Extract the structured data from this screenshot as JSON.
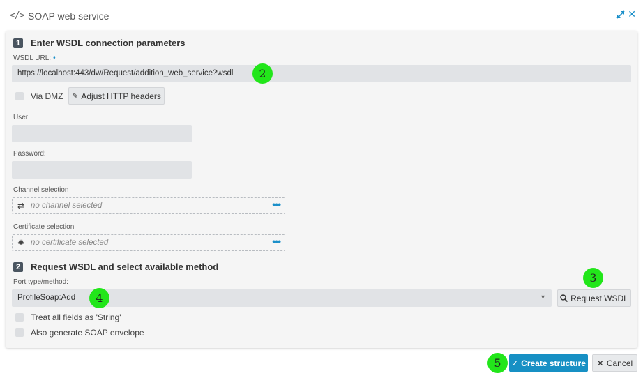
{
  "window": {
    "title": "SOAP web service",
    "title_icon": "</>",
    "close_symbol": "✕"
  },
  "section1": {
    "number": "1",
    "title": "Enter WSDL connection parameters",
    "wsdl_url_label": "WSDL URL:",
    "required_mark": "•",
    "wsdl_url_value": "https://localhost:443/dw/Request/addition_web_service?wsdl",
    "via_dmz_label": "Via DMZ",
    "adjust_headers_label": "Adjust HTTP headers",
    "user_label": "User:",
    "user_value": "",
    "password_label": "Password:",
    "password_value": "",
    "channel_label": "Channel selection",
    "channel_placeholder": "no channel selected",
    "certificate_label": "Certificate selection",
    "certificate_placeholder": "no certificate selected",
    "more_dots": "•••"
  },
  "section2": {
    "number": "2",
    "title": "Request WSDL and select available method",
    "port_label": "Port type/method:",
    "port_value": "ProfileSoap:Add",
    "request_wsdl_label": "Request WSDL",
    "treat_string_label": "Treat all fields as 'String'",
    "soap_envelope_label": "Also generate SOAP envelope"
  },
  "footer": {
    "create_label": "Create structure",
    "cancel_label": "Cancel"
  },
  "markers": [
    "2",
    "3",
    "4",
    "5"
  ],
  "colors": {
    "accent": "#1790c4",
    "marker": "#22e61a",
    "field_bg": "#e1e3e6"
  },
  "icons": {
    "title": "code-icon",
    "expand": "expand-icon",
    "close": "close-icon",
    "pencil": "pencil-icon",
    "channel": "swap-arrows-icon",
    "certificate": "certificate-icon",
    "search": "search-icon",
    "check": "check-icon",
    "cancel": "x-icon"
  }
}
